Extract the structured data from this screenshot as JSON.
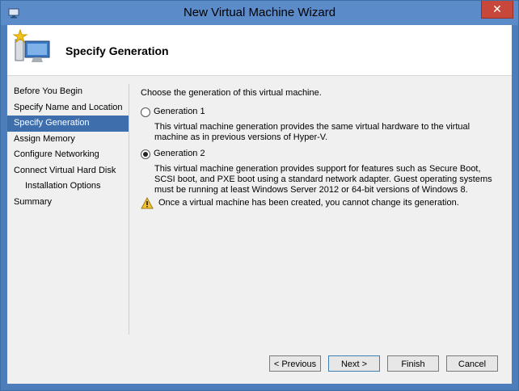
{
  "window": {
    "title": "New Virtual Machine Wizard",
    "close_label": "✕"
  },
  "header": {
    "title": "Specify Generation"
  },
  "nav": {
    "items": [
      {
        "label": "Before You Begin"
      },
      {
        "label": "Specify Name and Location"
      },
      {
        "label": "Specify Generation",
        "selected": true
      },
      {
        "label": "Assign Memory"
      },
      {
        "label": "Configure Networking"
      },
      {
        "label": "Connect Virtual Hard Disk"
      },
      {
        "label": "Installation Options",
        "indent": true
      },
      {
        "label": "Summary"
      }
    ]
  },
  "content": {
    "prompt": "Choose the generation of this virtual machine.",
    "options": [
      {
        "label": "Generation 1",
        "checked": false,
        "description": "This virtual machine generation provides the same virtual hardware to the virtual machine as in previous versions of Hyper-V."
      },
      {
        "label": "Generation 2",
        "checked": true,
        "description": "This virtual machine generation provides support for features such as Secure Boot, SCSI boot, and PXE boot using a standard network adapter. Guest operating systems must be running at least Windows Server 2012 or 64-bit versions of Windows 8."
      }
    ],
    "warning": "Once a virtual machine has been created, you cannot change its generation."
  },
  "buttons": {
    "previous": "< Previous",
    "next": "Next >",
    "finish": "Finish",
    "cancel": "Cancel"
  },
  "colors": {
    "titlebar": "#5b8bc9",
    "selected_nav": "#3f6ead",
    "close": "#c7483a"
  }
}
